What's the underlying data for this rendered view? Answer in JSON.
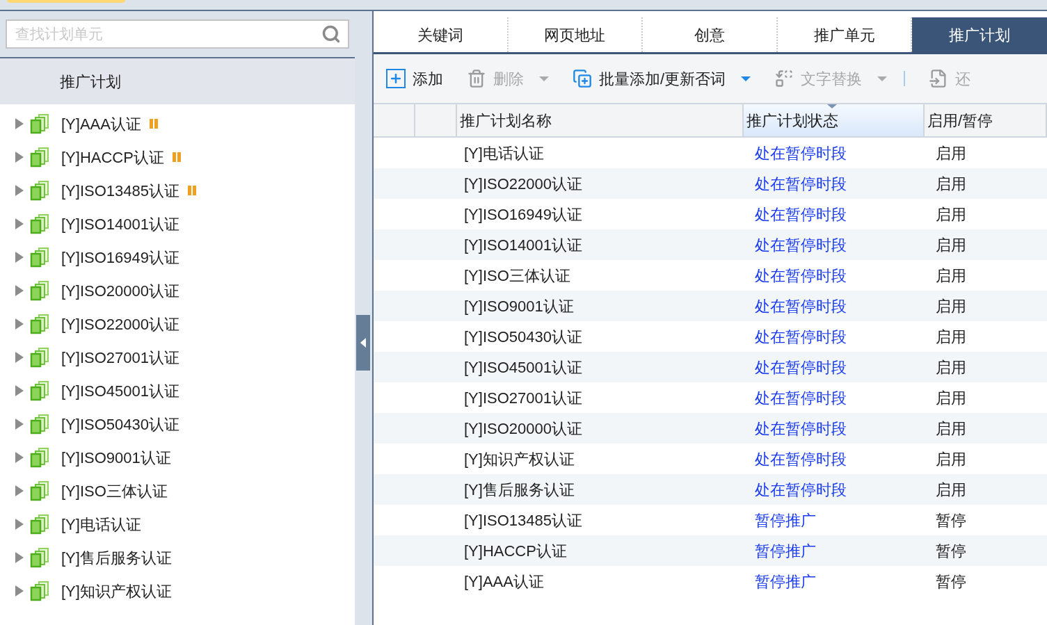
{
  "sidebar": {
    "search": {
      "placeholder": "查找计划单元"
    },
    "header": "推广计划",
    "items": [
      {
        "label": "[Y]AAA认证",
        "paused": true,
        "expanded": false
      },
      {
        "label": "[Y]HACCP认证",
        "paused": true,
        "expanded": false
      },
      {
        "label": "[Y]ISO13485认证",
        "paused": true,
        "expanded": false
      },
      {
        "label": "[Y]ISO14001认证",
        "paused": false,
        "expanded": false
      },
      {
        "label": "[Y]ISO16949认证",
        "paused": false,
        "expanded": false
      },
      {
        "label": "[Y]ISO20000认证",
        "paused": false,
        "expanded": false
      },
      {
        "label": "[Y]ISO22000认证",
        "paused": false,
        "expanded": false
      },
      {
        "label": "[Y]ISO27001认证",
        "paused": false,
        "expanded": false
      },
      {
        "label": "[Y]ISO45001认证",
        "paused": false,
        "expanded": false
      },
      {
        "label": "[Y]ISO50430认证",
        "paused": false,
        "expanded": false
      },
      {
        "label": "[Y]ISO9001认证",
        "paused": false,
        "expanded": false
      },
      {
        "label": "[Y]ISO三体认证",
        "paused": false,
        "expanded": false
      },
      {
        "label": "[Y]电话认证",
        "paused": false,
        "expanded": false
      },
      {
        "label": "[Y]售后服务认证",
        "paused": false,
        "expanded": false
      },
      {
        "label": "[Y]知识产权认证",
        "paused": false,
        "expanded": false
      }
    ]
  },
  "tabs": [
    {
      "label": "关键词",
      "selected": false
    },
    {
      "label": "网页地址",
      "selected": false
    },
    {
      "label": "创意",
      "selected": false
    },
    {
      "label": "推广单元",
      "selected": false
    },
    {
      "label": "推广计划",
      "selected": true
    }
  ],
  "toolbar": [
    {
      "kind": "add",
      "label": "添加",
      "disabled": false,
      "dropdown": false
    },
    {
      "kind": "delete",
      "label": "删除",
      "disabled": true,
      "dropdown": true
    },
    {
      "kind": "batch",
      "label": "批量添加/更新否词",
      "disabled": false,
      "dropdown": true
    },
    {
      "kind": "replace",
      "label": "文字替换",
      "disabled": true,
      "dropdown": true
    },
    {
      "kind": "restore",
      "label": "还",
      "disabled": true,
      "dropdown": false
    }
  ],
  "table": {
    "columns": [
      {
        "label": "推广计划名称",
        "sorted": false
      },
      {
        "label": "推广计划状态",
        "sorted": true
      },
      {
        "label": "启用/暂停",
        "sorted": false
      }
    ],
    "rows": [
      {
        "name": "[Y]电话认证",
        "status": "处在暂停时段",
        "enabled": "启用"
      },
      {
        "name": "[Y]ISO22000认证",
        "status": "处在暂停时段",
        "enabled": "启用"
      },
      {
        "name": "[Y]ISO16949认证",
        "status": "处在暂停时段",
        "enabled": "启用"
      },
      {
        "name": "[Y]ISO14001认证",
        "status": "处在暂停时段",
        "enabled": "启用"
      },
      {
        "name": "[Y]ISO三体认证",
        "status": "处在暂停时段",
        "enabled": "启用"
      },
      {
        "name": "[Y]ISO9001认证",
        "status": "处在暂停时段",
        "enabled": "启用"
      },
      {
        "name": "[Y]ISO50430认证",
        "status": "处在暂停时段",
        "enabled": "启用"
      },
      {
        "name": "[Y]ISO45001认证",
        "status": "处在暂停时段",
        "enabled": "启用"
      },
      {
        "name": "[Y]ISO27001认证",
        "status": "处在暂停时段",
        "enabled": "启用"
      },
      {
        "name": "[Y]ISO20000认证",
        "status": "处在暂停时段",
        "enabled": "启用"
      },
      {
        "name": "[Y]知识产权认证",
        "status": "处在暂停时段",
        "enabled": "启用"
      },
      {
        "name": "[Y]售后服务认证",
        "status": "处在暂停时段",
        "enabled": "启用"
      },
      {
        "name": "[Y]ISO13485认证",
        "status": "暂停推广",
        "enabled": "暂停"
      },
      {
        "name": "[Y]HACCP认证",
        "status": "暂停推广",
        "enabled": "暂停"
      },
      {
        "name": "[Y]AAA认证",
        "status": "暂停推广",
        "enabled": "暂停"
      }
    ]
  }
}
